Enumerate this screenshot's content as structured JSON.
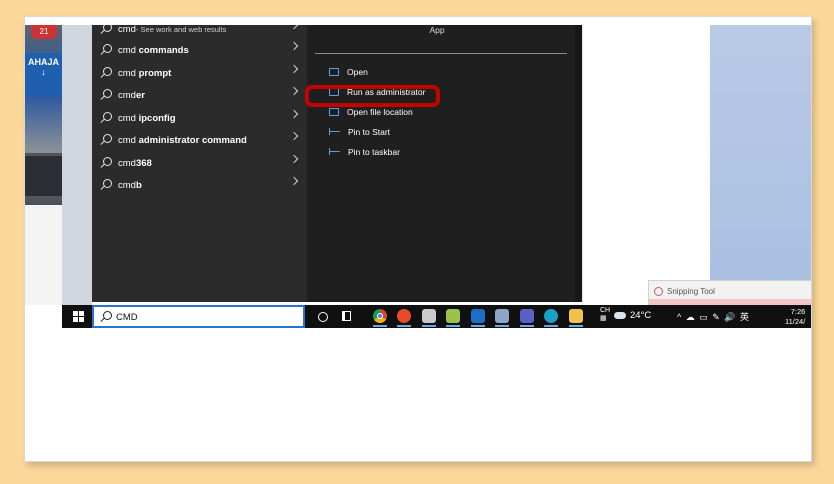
{
  "photo": {
    "sign_number": "21",
    "sign_text": "AHAJA"
  },
  "search_results": [
    {
      "prefix": "cmd",
      "bold": "",
      "suffix": " - See work and web results"
    },
    {
      "prefix": "cmd ",
      "bold": "commands",
      "suffix": ""
    },
    {
      "prefix": "cmd ",
      "bold": "prompt",
      "suffix": ""
    },
    {
      "prefix": "cmd",
      "bold": "er",
      "suffix": ""
    },
    {
      "prefix": "cmd ",
      "bold": "ipconfig",
      "suffix": ""
    },
    {
      "prefix": "cmd ",
      "bold": "administrator command",
      "suffix": ""
    },
    {
      "prefix": "cmd",
      "bold": "368",
      "suffix": ""
    },
    {
      "prefix": "cmd",
      "bold": "b",
      "suffix": ""
    }
  ],
  "detail": {
    "app_label": "App",
    "actions": [
      {
        "label": "Open",
        "icon": "open-window-icon"
      },
      {
        "label": "Run as administrator",
        "icon": "admin-shield-icon"
      },
      {
        "label": "Open file location",
        "icon": "folder-icon"
      },
      {
        "label": "Pin to Start",
        "icon": "pin-icon"
      },
      {
        "label": "Pin to taskbar",
        "icon": "pin-icon"
      }
    ]
  },
  "snipping_tool": {
    "title": "Snipping Tool"
  },
  "taskbar": {
    "search_value": "CMD",
    "ime_top": "CH",
    "weather": "24°C",
    "tray_text": "^ ☁ ▭ ✎ 🔊 英",
    "time": "7:26",
    "date": "11/24/"
  },
  "colors": {
    "highlight": "#c40000",
    "accent": "#2b73d0",
    "menu_bg": "#2b2b2b"
  }
}
